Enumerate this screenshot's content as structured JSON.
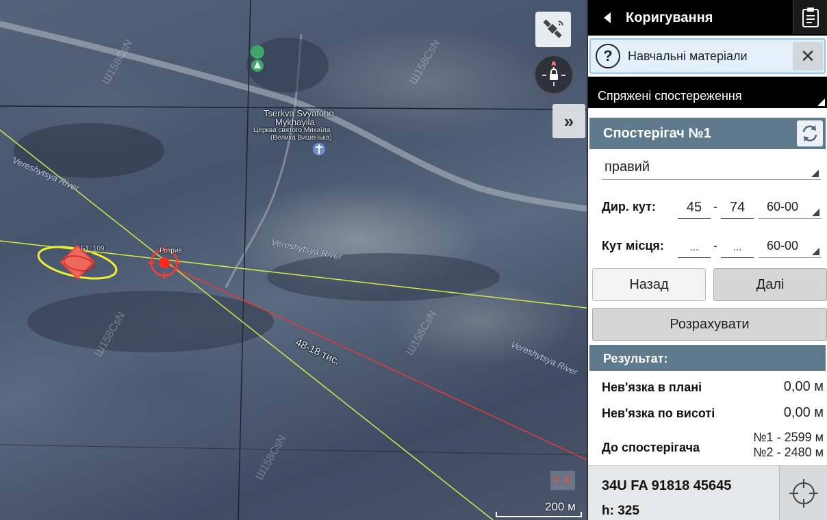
{
  "map": {
    "church_name_en_1": "Tserkva Svyatoho",
    "church_name_en_2": "Mykhayila",
    "church_name_uk_1": "Церква святого Михаїла",
    "church_name_uk_2": "(Велика Вишенька)",
    "river_label": "Vereshytsya River",
    "marker_target_label": "БТ_109",
    "marker_burst_label": "Розрив",
    "line_label": "48-18 тис.",
    "watermark": "Ш158CsN",
    "tf_badge": "T F",
    "scale_label": "200 м",
    "colors": {
      "observer_line": "#d8e84a",
      "target_line": "#e83a3a",
      "marker": "#ff3b30"
    }
  },
  "panel": {
    "header_title": "Коригування",
    "help_text": "Навчальні матеріали",
    "mode_value": "Спряжені спостереження",
    "observer_title": "Спостерігач №1",
    "side_value": "правий",
    "azimuth": {
      "label": "Дир. кут:",
      "major": "45",
      "minor": "74",
      "unit": "60-00"
    },
    "elevation": {
      "label": "Кут місця:",
      "major": "...",
      "minor": "...",
      "unit": "60-00"
    },
    "back_button": "Назад",
    "next_button": "Далі",
    "calc_button": "Розрахувати",
    "result_title": "Результат:",
    "results": {
      "plan_label": "Нев'язка в плані",
      "plan_value": "0,00 м",
      "height_label": "Нев'язка по висоті",
      "height_value": "0,00 м",
      "observer_label": "До спостерігача",
      "observer_value_1": "№1 - 2599 м",
      "observer_value_2": "№2 - 2480 м"
    },
    "coordinates": "34U FA 91818 45645",
    "height_text": "h: 325"
  }
}
